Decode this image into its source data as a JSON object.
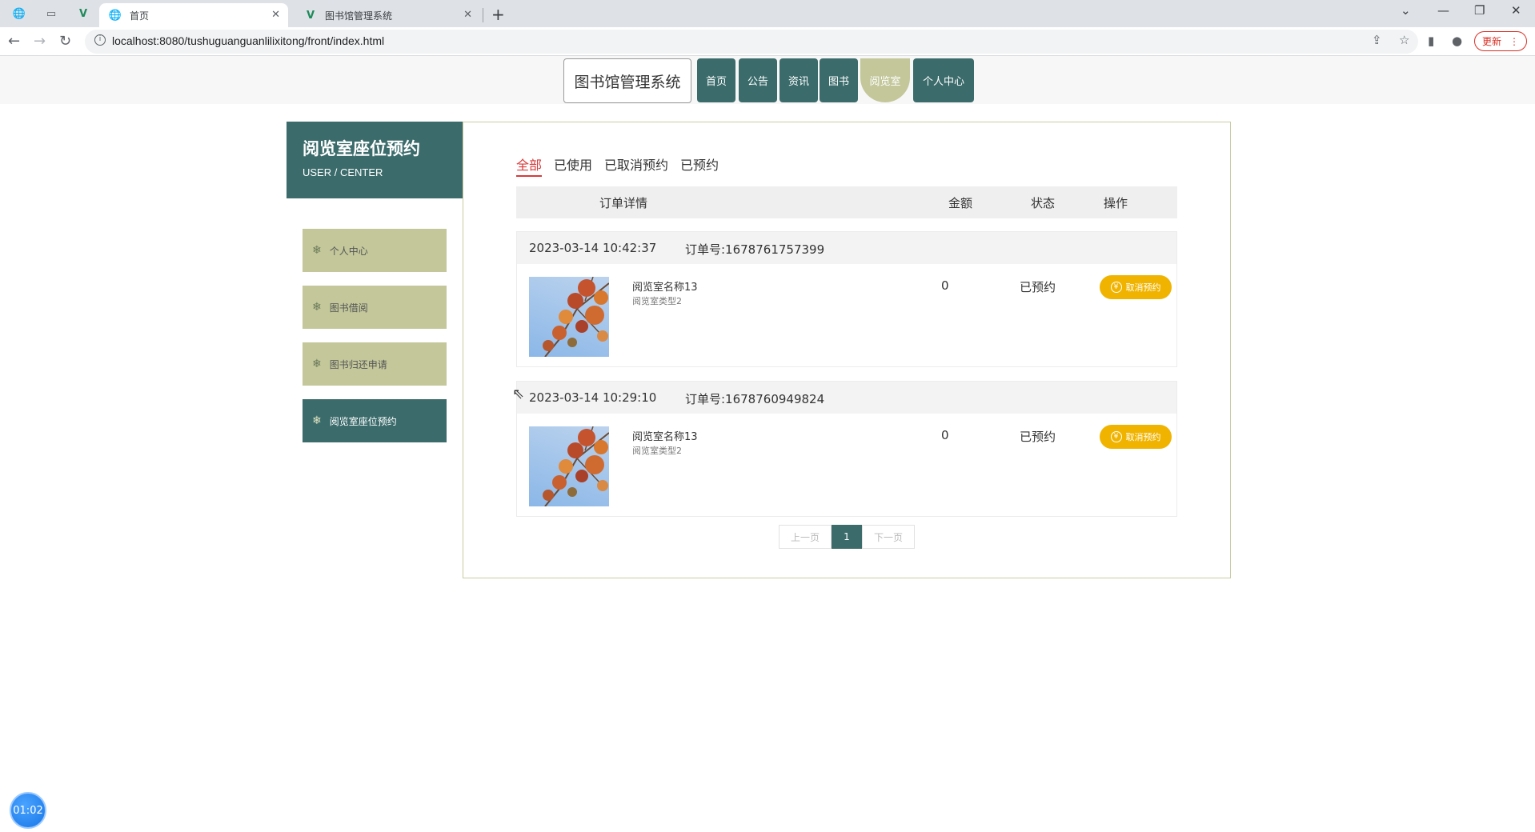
{
  "browser": {
    "tabs": [
      {
        "title": "首页",
        "active": true
      },
      {
        "title": "图书馆管理系统",
        "active": false
      }
    ],
    "url": "localhost:8080/tushuguanguanlilixitong/front/index.html",
    "update_label": "更新",
    "icons": {
      "back": "back-arrow-icon",
      "forward": "forward-arrow-icon",
      "reload": "reload-icon",
      "share": "share-icon",
      "star": "bookmark-star-icon",
      "sidebar": "sidebar-icon",
      "profile": "profile-icon"
    }
  },
  "header": {
    "site_title": "图书馆管理系统",
    "nav": [
      {
        "label": "首页",
        "active": false
      },
      {
        "label": "公告",
        "active": false
      },
      {
        "label": "资讯",
        "active": false
      },
      {
        "label": "图书",
        "active": false
      },
      {
        "label": "阅览室",
        "active": true
      },
      {
        "label": "个人中心",
        "active": false
      }
    ]
  },
  "sidebar": {
    "title": "阅览室座位预约",
    "subtitle": "USER / CENTER",
    "items": [
      {
        "label": "个人中心",
        "active": false
      },
      {
        "label": "图书借阅",
        "active": false
      },
      {
        "label": "图书归还申请",
        "active": false
      },
      {
        "label": "阅览室座位预约",
        "active": true
      }
    ]
  },
  "main": {
    "filters": [
      {
        "label": "全部",
        "active": true
      },
      {
        "label": "已使用",
        "active": false
      },
      {
        "label": "已取消预约",
        "active": false
      },
      {
        "label": "已预约",
        "active": false
      }
    ],
    "columns": {
      "detail": "订单详情",
      "amount": "金额",
      "status": "状态",
      "action": "操作"
    },
    "orders": [
      {
        "date": "2023-03-14 10:42:37",
        "order_no": "订单号:1678761757399",
        "name": "阅览室名称13",
        "type": "阅览室类型2",
        "amount": "0",
        "status": "已预约",
        "action": "取消预约"
      },
      {
        "date": "2023-03-14 10:29:10",
        "order_no": "订单号:1678760949824",
        "name": "阅览室名称13",
        "type": "阅览室类型2",
        "amount": "0",
        "status": "已预约",
        "action": "取消预约"
      }
    ],
    "pager": {
      "prev": "上一页",
      "current": "1",
      "next": "下一页"
    }
  },
  "timer": "01:02",
  "colors": {
    "primary": "#3b6b6b",
    "secondary": "#c3c79a",
    "danger": "#d83a3a",
    "warning": "#f0b400"
  }
}
